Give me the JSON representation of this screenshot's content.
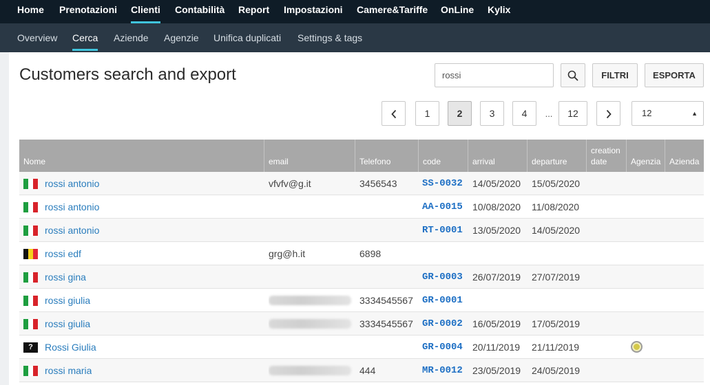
{
  "topnav": {
    "items": [
      {
        "label": "Home",
        "active": false
      },
      {
        "label": "Prenotazioni",
        "active": false
      },
      {
        "label": "Clienti",
        "active": true
      },
      {
        "label": "Contabilità",
        "active": false
      },
      {
        "label": "Report",
        "active": false
      },
      {
        "label": "Impostazioni",
        "active": false
      },
      {
        "label": "Camere&Tariffe",
        "active": false
      },
      {
        "label": "OnLine",
        "active": false
      },
      {
        "label": "Kylix",
        "active": false
      }
    ]
  },
  "subnav": {
    "items": [
      {
        "label": "Overview",
        "active": false
      },
      {
        "label": "Cerca",
        "active": true
      },
      {
        "label": "Aziende",
        "active": false
      },
      {
        "label": "Agenzie",
        "active": false
      },
      {
        "label": "Unifica duplicati",
        "active": false
      },
      {
        "label": "Settings & tags",
        "active": false
      }
    ]
  },
  "page": {
    "title": "Customers search and export"
  },
  "toolbar": {
    "search_value": "rossi",
    "search_icon": "search-icon",
    "filtri_label": "FILTRI",
    "esporta_label": "ESPORTA"
  },
  "pagination": {
    "prev_icon": "‹",
    "next_icon": "›",
    "pages": [
      "1",
      "2",
      "3",
      "4"
    ],
    "current": "2",
    "ellipsis": "...",
    "last": "12",
    "per_page": "12"
  },
  "table": {
    "columns": [
      "Nome",
      "email",
      "Telefono",
      "code",
      "arrival",
      "departure",
      "creation date",
      "Agenzia",
      "Azienda"
    ],
    "rows": [
      {
        "flag": "it",
        "name": "rossi antonio",
        "email": "vfvfv@g.it",
        "email_blurred": false,
        "phone": "3456543",
        "code": "SS-0032",
        "arrival": "14/05/2020",
        "departure": "15/05/2020",
        "agency_dot": false
      },
      {
        "flag": "it",
        "name": "rossi antonio",
        "email": "",
        "email_blurred": false,
        "phone": "",
        "code": "AA-0015",
        "arrival": "10/08/2020",
        "departure": "11/08/2020",
        "agency_dot": false
      },
      {
        "flag": "it",
        "name": "rossi antonio",
        "email": "",
        "email_blurred": false,
        "phone": "",
        "code": "RT-0001",
        "arrival": "13/05/2020",
        "departure": "14/05/2020",
        "agency_dot": false
      },
      {
        "flag": "be",
        "name": "rossi edf",
        "email": "grg@h.it",
        "email_blurred": false,
        "phone": "6898",
        "code": "",
        "arrival": "",
        "departure": "",
        "agency_dot": false
      },
      {
        "flag": "it",
        "name": "rossi gina",
        "email": "",
        "email_blurred": false,
        "phone": "",
        "code": "GR-0003",
        "arrival": "26/07/2019",
        "departure": "27/07/2019",
        "agency_dot": false
      },
      {
        "flag": "it",
        "name": "rossi giulia",
        "email": "",
        "email_blurred": true,
        "phone": "3334545567",
        "code": "GR-0001",
        "arrival": "",
        "departure": "",
        "agency_dot": false
      },
      {
        "flag": "it",
        "name": "rossi giulia",
        "email": "",
        "email_blurred": true,
        "phone": "3334545567",
        "code": "GR-0002",
        "arrival": "16/05/2019",
        "departure": "17/05/2019",
        "agency_dot": false
      },
      {
        "flag": "unknown",
        "name": "Rossi Giulia",
        "email": "",
        "email_blurred": false,
        "phone": "",
        "code": "GR-0004",
        "arrival": "20/11/2019",
        "departure": "21/11/2019",
        "agency_dot": true
      },
      {
        "flag": "it",
        "name": "rossi maria",
        "email": "",
        "email_blurred": true,
        "phone": "444",
        "code": "MR-0012",
        "arrival": "23/05/2019",
        "departure": "24/05/2019",
        "agency_dot": false
      }
    ]
  },
  "colors": {
    "topnav_bg": "#0f1c27",
    "subnav_bg": "#2a3845",
    "accent": "#40c4dc",
    "link": "#2a7dbd",
    "header_bg": "#a8a8a8"
  }
}
